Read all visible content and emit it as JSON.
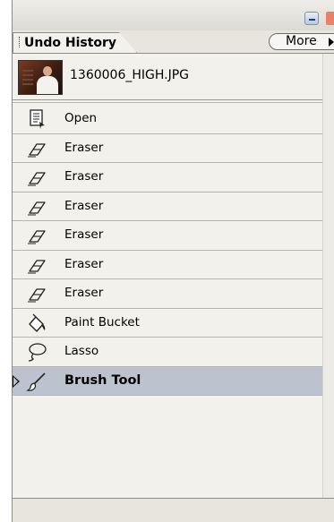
{
  "panel": {
    "tab_label": "Undo History",
    "more_label": "More"
  },
  "snapshot": {
    "label": "1360006_HIGH.JPG"
  },
  "history": [
    {
      "label": "Open",
      "icon": "open-document-icon",
      "selected": false
    },
    {
      "label": "Eraser",
      "icon": "eraser-icon",
      "selected": false
    },
    {
      "label": "Eraser",
      "icon": "eraser-icon",
      "selected": false
    },
    {
      "label": "Eraser",
      "icon": "eraser-icon",
      "selected": false
    },
    {
      "label": "Eraser",
      "icon": "eraser-icon",
      "selected": false
    },
    {
      "label": "Eraser",
      "icon": "eraser-icon",
      "selected": false
    },
    {
      "label": "Eraser",
      "icon": "eraser-icon",
      "selected": false
    },
    {
      "label": "Paint Bucket",
      "icon": "paint-bucket-icon",
      "selected": false
    },
    {
      "label": "Lasso",
      "icon": "lasso-icon",
      "selected": false
    },
    {
      "label": "Brush Tool",
      "icon": "brush-icon",
      "selected": true
    }
  ],
  "colors": {
    "selected_row": "#bcc3ce",
    "panel_bg": "#f2f1ec"
  }
}
